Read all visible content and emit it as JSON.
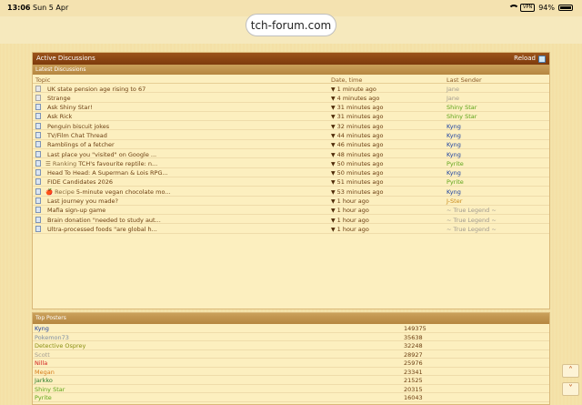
{
  "status": {
    "time": "13:06",
    "date": "Sun 5 Apr",
    "vpn": "VPN",
    "battery": "94%"
  },
  "browser": {
    "url": "tch-forum.com"
  },
  "discussions": {
    "title": "Active Discussions",
    "reload_label": "Reload",
    "subheader": "Latest Discussions",
    "columns": {
      "topic": "Topic",
      "time": "Date, time",
      "sender": "Last Sender"
    },
    "rows": [
      {
        "tag": "",
        "topic": "UK state pension age rising to 67",
        "time": "1 minute ago",
        "sender": "Jane",
        "color": "#a29b8f",
        "unread": true
      },
      {
        "tag": "",
        "topic": "Strange",
        "time": "4 minutes ago",
        "sender": "Jane",
        "color": "#a29b8f",
        "unread": true
      },
      {
        "tag": "",
        "topic": "Ask Shiny Star!",
        "time": "31 minutes ago",
        "sender": "Shiny Star",
        "color": "#5ea418",
        "unread": false
      },
      {
        "tag": "",
        "topic": "Ask Rick",
        "time": "31 minutes ago",
        "sender": "Shiny Star",
        "color": "#5ea418",
        "unread": false
      },
      {
        "tag": "",
        "topic": "Penguin biscuit jokes",
        "time": "32 minutes ago",
        "sender": "Kyng",
        "color": "#1a3fa0",
        "unread": false
      },
      {
        "tag": "",
        "topic": "TV/Film Chat Thread",
        "time": "44 minutes ago",
        "sender": "Kyng",
        "color": "#1a3fa0",
        "unread": false
      },
      {
        "tag": "",
        "topic": "Ramblings of a fetcher",
        "time": "46 minutes ago",
        "sender": "Kyng",
        "color": "#1a3fa0",
        "unread": false
      },
      {
        "tag": "",
        "topic": "Last place you \"visited\" on Google ...",
        "time": "48 minutes ago",
        "sender": "Kyng",
        "color": "#1a3fa0",
        "unread": false
      },
      {
        "tag": "☰ Ranking",
        "topic": "TCH's favourite reptile: n...",
        "time": "50 minutes ago",
        "sender": "Pyrite",
        "color": "#5ea418",
        "unread": false
      },
      {
        "tag": "",
        "topic": "Head To Head: A Superman & Lois RPG...",
        "time": "50 minutes ago",
        "sender": "Kyng",
        "color": "#1a3fa0",
        "unread": false
      },
      {
        "tag": "",
        "topic": "FIDE Candidates 2026",
        "time": "51 minutes ago",
        "sender": "Pyrite",
        "color": "#5ea418",
        "unread": false
      },
      {
        "tag": "🍎 Recipe",
        "topic": "5-minute vegan chocolate mo...",
        "time": "53 minutes ago",
        "sender": "Kyng",
        "color": "#1a3fa0",
        "unread": false
      },
      {
        "tag": "",
        "topic": "Last journey you made?",
        "time": "1 hour ago",
        "sender": "J-Ster",
        "color": "#c98a1a",
        "unread": false
      },
      {
        "tag": "",
        "topic": "Mafia sign-up game",
        "time": "1 hour ago",
        "sender": "~ True Legend ~",
        "color": "#a29b8f",
        "unread": false
      },
      {
        "tag": "",
        "topic": "Brain donation \"needed to study aut...",
        "time": "1 hour ago",
        "sender": "~ True Legend ~",
        "color": "#a29b8f",
        "unread": false
      },
      {
        "tag": "",
        "topic": "Ultra-processed foods \"are global h...",
        "time": "1 hour ago",
        "sender": "~ True Legend ~",
        "color": "#a29b8f",
        "unread": false
      }
    ]
  },
  "top_posters": {
    "title": "Top Posters",
    "rows": [
      {
        "name": "Kyng",
        "count": "149375",
        "color": "#1a3fa0"
      },
      {
        "name": "Pokemon73",
        "count": "35638",
        "color": "#7f8fa5"
      },
      {
        "name": "Detective Osprey",
        "count": "32248",
        "color": "#8a8f12"
      },
      {
        "name": "Scott",
        "count": "28927",
        "color": "#a29b8f"
      },
      {
        "name": "Nilla",
        "count": "25976",
        "color": "#d21e1e"
      },
      {
        "name": "Megan",
        "count": "23341",
        "color": "#d77b1a"
      },
      {
        "name": "Jarkko",
        "count": "21525",
        "color": "#2a7a2a"
      },
      {
        "name": "Shiny Star",
        "count": "20315",
        "color": "#5ea418"
      },
      {
        "name": "Pyrite",
        "count": "16043",
        "color": "#5ea418"
      }
    ]
  }
}
